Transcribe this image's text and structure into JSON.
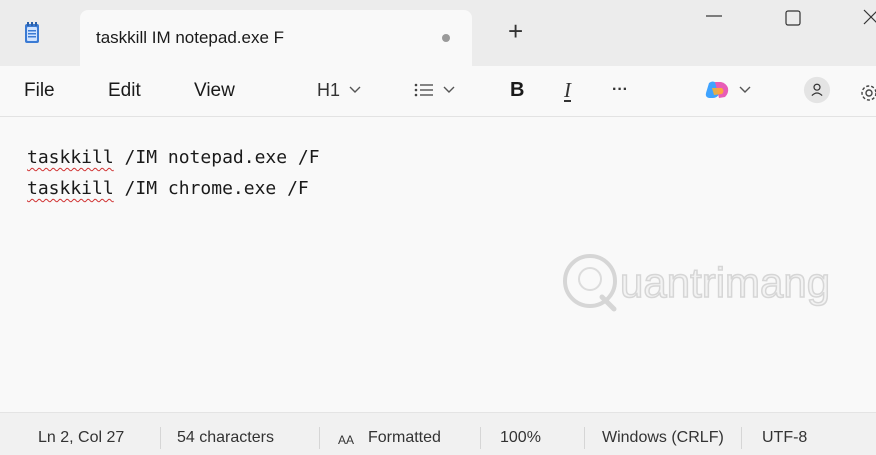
{
  "tab": {
    "title": "taskkill IM notepad.exe F"
  },
  "menu": {
    "file": "File",
    "edit": "Edit",
    "view": "View"
  },
  "toolbar": {
    "heading": "H1",
    "bold": "B",
    "italic": "I",
    "more": "···"
  },
  "editor": {
    "lines": [
      {
        "word": "taskkill",
        "rest": " /IM notepad.exe /F"
      },
      {
        "word": "taskkill",
        "rest": " /IM chrome.exe /F"
      }
    ]
  },
  "watermark": {
    "text": "uantrimang",
    "letter": "Q"
  },
  "status": {
    "position": "Ln 2, Col 27",
    "characters": "54 characters",
    "format": "Formatted",
    "zoom": "100%",
    "line_ending": "Windows (CRLF)",
    "encoding": "UTF-8"
  },
  "icons": {
    "app": "notepad-icon",
    "copilot": "copilot-icon",
    "account": "account-icon",
    "settings": "settings-gear-icon"
  },
  "colors": {
    "accent_copilot": "#7b61ff",
    "spell_error": "#d03030"
  }
}
